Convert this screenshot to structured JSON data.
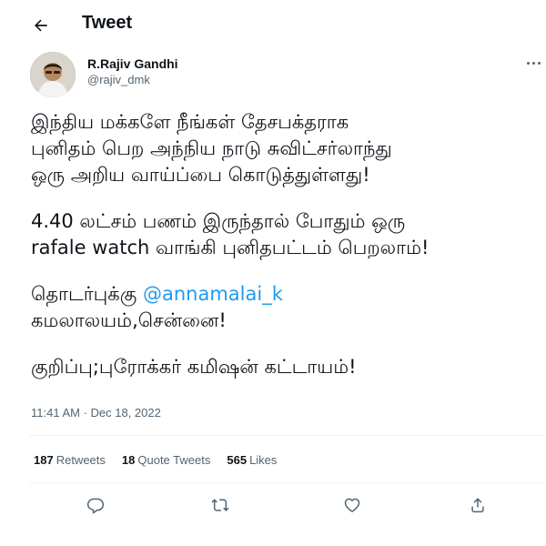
{
  "header": {
    "title": "Tweet",
    "back_icon": "arrow-left-icon"
  },
  "author": {
    "display_name": "R.Rajiv Gandhi",
    "handle": "@rajiv_dmk",
    "more_icon": "more-horizontal-icon"
  },
  "tweet": {
    "lines": [
      "இந்திய மக்களே நீங்கள் தேசபக்தராக",
      "புனிதம் பெற அந்நிய நாடு சுவிட்சர்லாந்து",
      "ஒரு அறிய வாய்ப்பை கொடுத்துள்ளது!",
      "4.40 லட்சம் பணம் இருந்தால் போதும் ஒரு",
      "rafale watch வாங்கி புனிதபட்டம் பெறலாம்!",
      "தொடர்புக்கு",
      "கமலாலயம்,சென்னை!",
      "குறிப்பு;புரோக்கர் கமிஷன் கட்டாயம்!"
    ],
    "mention": "@annamalai_k"
  },
  "timestamp": "11:41 AM · Dec 18, 2022",
  "stats": {
    "retweets_count": "187",
    "retweets_label": "Retweets",
    "quotes_count": "18",
    "quotes_label": "Quote Tweets",
    "likes_count": "565",
    "likes_label": "Likes"
  },
  "actions": {
    "icons": [
      "reply-icon",
      "retweet-icon",
      "like-icon",
      "share-icon"
    ]
  },
  "colors": {
    "text": "#0f1419",
    "secondary": "#536471",
    "link": "#1d9bf0",
    "divider": "#eff3f4"
  }
}
